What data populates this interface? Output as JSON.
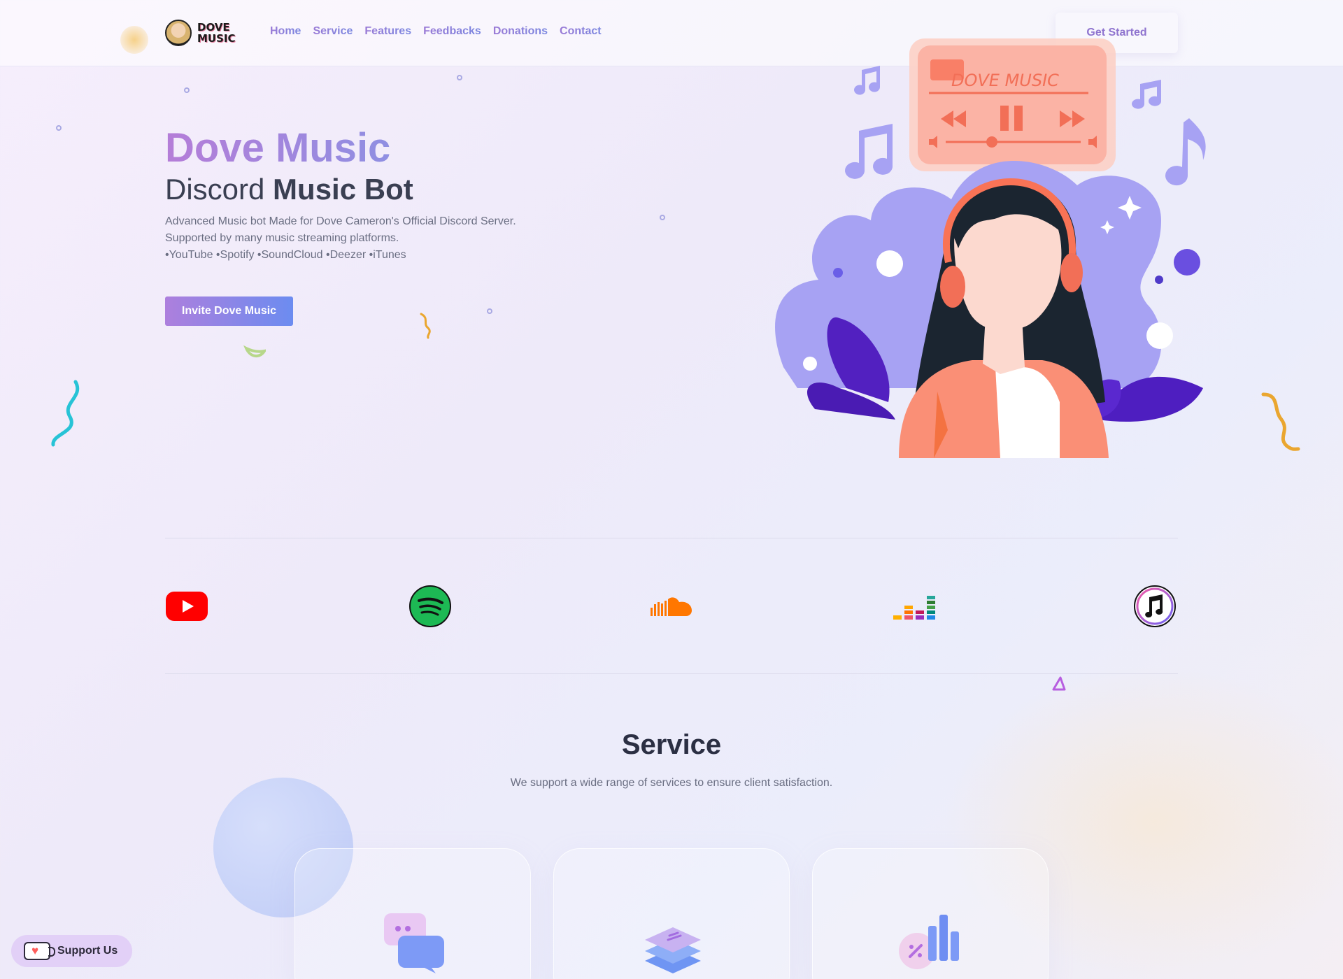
{
  "brand": {
    "logo_text": "DOVE MUSIC"
  },
  "nav": {
    "items": [
      "Home",
      "Service",
      "Features",
      "Feedbacks",
      "Donations",
      "Contact"
    ],
    "cta": "Get Started"
  },
  "hero": {
    "title": "Dove Music",
    "subtitle_light": "Discord ",
    "subtitle_bold": "Music Bot",
    "description_line1": "Advanced Music bot Made for Dove Cameron's Official Discord Server.",
    "description_line2": "Supported by many music streaming platforms.",
    "description_line3": "•YouTube •Spotify •SoundCloud •Deezer •iTunes",
    "invite_button": "Invite Dove Music",
    "illustration_player_text": "DOVE MUSIC"
  },
  "platforms": [
    {
      "name": "youtube-icon",
      "color": "#ff0000"
    },
    {
      "name": "spotify-icon",
      "color": "#1db954"
    },
    {
      "name": "soundcloud-icon",
      "color": "#ff7700"
    },
    {
      "name": "deezer-icon",
      "color": "#ef5466"
    },
    {
      "name": "itunes-icon",
      "color": "#b65de8"
    }
  ],
  "service": {
    "title": "Service",
    "description": "We support a wide range of services to ensure client satisfaction.",
    "cards": [
      {
        "icon": "chat-bubbles-icon"
      },
      {
        "icon": "layers-icon"
      },
      {
        "icon": "bar-chart-icon"
      }
    ]
  },
  "support": {
    "label": "Support Us",
    "icon": "kofi-cup-icon"
  },
  "colors": {
    "accent_purple": "#b57dd8",
    "accent_blue": "#6c8cf0",
    "illustration_violet": "#a7a2f3",
    "illustration_coral": "#fa8f76"
  }
}
